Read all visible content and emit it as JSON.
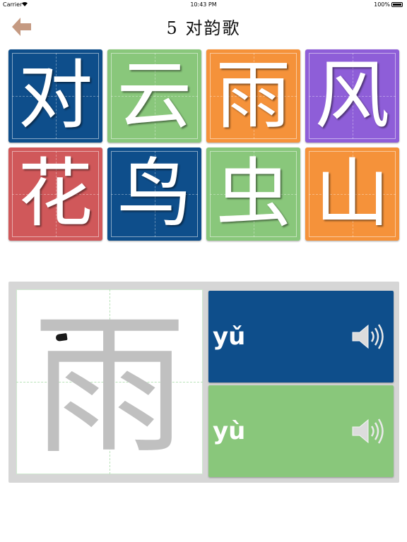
{
  "status_bar": {
    "carrier": "Carrier",
    "time": "10:43 PM",
    "battery": "100%"
  },
  "header": {
    "title": "5 对韵歌",
    "back_icon": "back-arrow-icon"
  },
  "colors": {
    "blue": "#0e4e8b",
    "green": "#89c77b",
    "orange": "#f5923a",
    "purple": "#8e5ed8",
    "red": "#d0585a",
    "arrow": "#c59a82",
    "panel": "#d6d6d6"
  },
  "characters": [
    {
      "char": "对",
      "color": "#0e4e8b"
    },
    {
      "char": "云",
      "color": "#89c77b"
    },
    {
      "char": "雨",
      "color": "#f5923a"
    },
    {
      "char": "风",
      "color": "#8e5ed8"
    },
    {
      "char": "花",
      "color": "#d0585a"
    },
    {
      "char": "鸟",
      "color": "#0e4e8b"
    },
    {
      "char": "虫",
      "color": "#89c77b"
    },
    {
      "char": "山",
      "color": "#f5923a"
    }
  ],
  "detail": {
    "character": "雨",
    "pronunciations": [
      {
        "pinyin": "yǔ",
        "color": "#0e4e8b",
        "icon": "speaker-icon"
      },
      {
        "pinyin": "yù",
        "color": "#89c77b",
        "icon": "speaker-icon"
      }
    ]
  }
}
